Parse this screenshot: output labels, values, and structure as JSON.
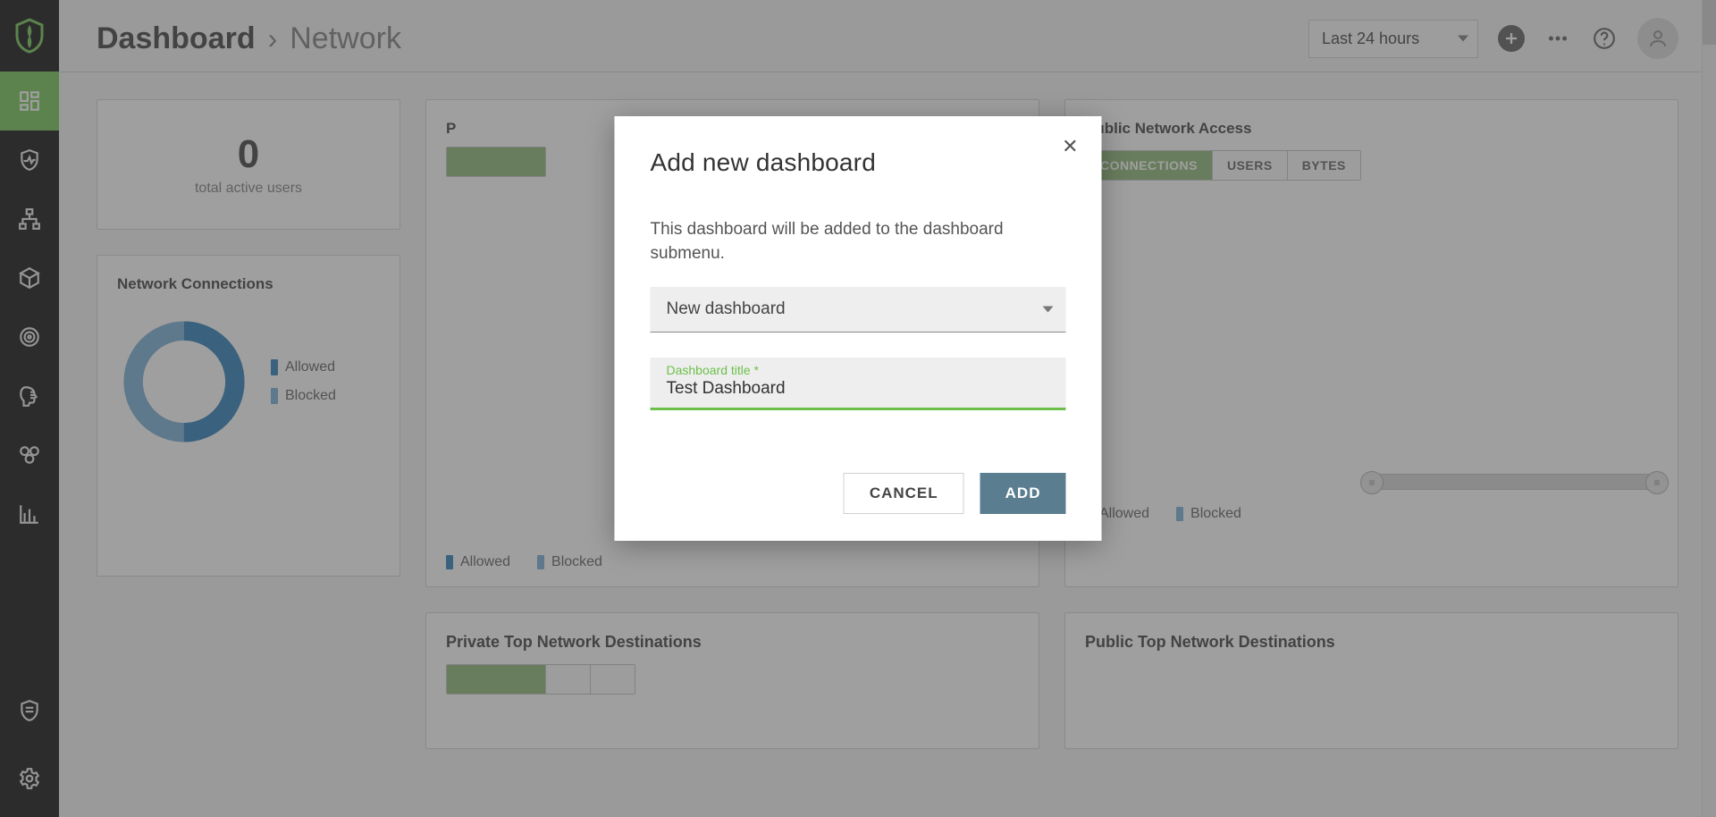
{
  "header": {
    "breadcrumb_root": "Dashboard",
    "breadcrumb_sep": "›",
    "breadcrumb_leaf": "Network",
    "time_range": "Last 24 hours"
  },
  "sidebar": {
    "items": [
      {
        "id": "logo"
      },
      {
        "id": "dashboard"
      },
      {
        "id": "shield"
      },
      {
        "id": "hierarchy"
      },
      {
        "id": "box"
      },
      {
        "id": "target"
      },
      {
        "id": "head"
      },
      {
        "id": "clusters"
      },
      {
        "id": "bar-chart"
      },
      {
        "id": "badge"
      },
      {
        "id": "gear"
      }
    ]
  },
  "cards": {
    "active_users": {
      "value": "0",
      "caption": "total active users"
    },
    "network_conn": {
      "title": "Network Connections",
      "legend_allowed": "Allowed",
      "legend_blocked": "Blocked"
    },
    "private_access": {
      "title_prefix": "P",
      "legend_allowed": "Allowed",
      "legend_blocked": "Blocked"
    },
    "public_access": {
      "title": "Public Network Access",
      "tabs": {
        "connections": "CONNECTIONS",
        "users": "USERS",
        "bytes": "BYTES"
      },
      "legend_allowed": "Allowed",
      "legend_blocked": "Blocked"
    },
    "private_top": {
      "title": "Private Top Network Destinations"
    },
    "public_top": {
      "title": "Public Top Network Destinations"
    }
  },
  "dialog": {
    "title": "Add new dashboard",
    "description": "This dashboard will be added to the dashboard submenu.",
    "select_value": "New dashboard",
    "input_label": "Dashboard title *",
    "input_value": "Test Dashboard",
    "cancel": "CANCEL",
    "add": "ADD"
  },
  "colors": {
    "blue_dark": "#1f77b4",
    "blue_light": "#6fa8d6"
  }
}
